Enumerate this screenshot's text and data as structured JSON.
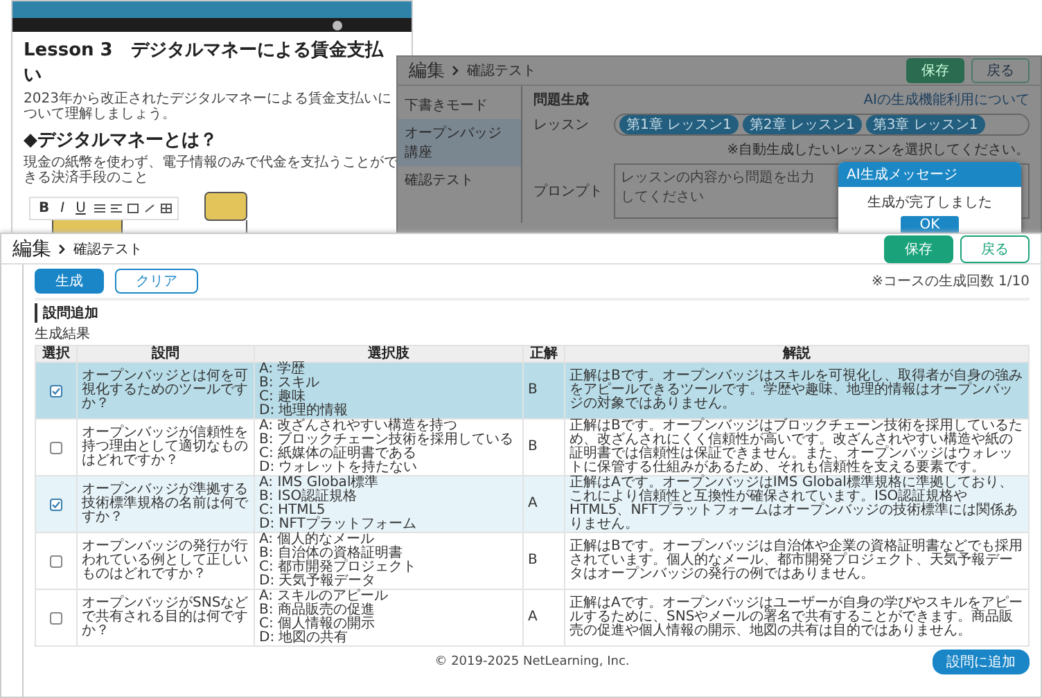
{
  "lesson_window": {
    "title": "Lesson 3　デジタルマネーによる賃金支払い",
    "intro": "2023年から改正されたデジタルマネーによる賃金支払いについて理解しましょう。",
    "heading": "◆デジタルマネーとは？",
    "definition": "現金の紙幣を使わず、電子情報のみで代金を支払うことができる決済手段のこと",
    "toolbar": [
      "B",
      "I",
      "U"
    ]
  },
  "background_editor": {
    "title": "編集",
    "breadcrumb": "確認テスト",
    "buttons": [
      {
        "label": "保存",
        "kind": "primary"
      },
      {
        "label": "戻る",
        "kind": "secondary"
      }
    ],
    "sidebar": {
      "items": [
        {
          "label": "下書きモード",
          "selected": false
        },
        {
          "label": "オープンバッジ講座",
          "selected": true
        },
        {
          "label": "確認テスト",
          "selected": false
        }
      ]
    },
    "section_title": "問題生成",
    "help_link": "AIの生成機能利用について",
    "lesson_field": {
      "label": "レッスン",
      "tags": [
        "第1章 レッスン1",
        "第2章 レッスン1",
        "第3章 レッスン1"
      ]
    },
    "note": "※自動生成したいレッスンを選択してください。",
    "prompt_field": {
      "label": "プロンプト",
      "placeholder": "レッスンの内容から問題を出力してください"
    },
    "dialog": {
      "title": "AI生成メッセージ",
      "message": "生成が完了しました",
      "button": "OK"
    }
  },
  "front_editor": {
    "title": "編集",
    "breadcrumb": "確認テスト",
    "buttons": [
      {
        "label": "保存",
        "kind": "primary"
      },
      {
        "label": "戻る",
        "kind": "secondary"
      }
    ],
    "actions": [
      {
        "label": "生成",
        "kind": "primary"
      },
      {
        "label": "クリア",
        "kind": "secondary"
      }
    ],
    "generation_count": "※コースの生成回数 1/10",
    "section_title": "設問追加",
    "results_label": "生成結果",
    "table": {
      "columns": [
        "選択",
        "設問",
        "選択肢",
        "正解",
        "解説"
      ],
      "rows": [
        {
          "checked": true,
          "hovered": true,
          "question": "オープンバッジとは何を可視化するためのツールですか？",
          "options": [
            "A: 学歴",
            "B: スキル",
            "C: 趣味",
            "D: 地理的情報"
          ],
          "answer": "B",
          "explanation": "正解はBです。オープンバッジはスキルを可視化し、取得者が自身の強みをアピールできるツールです。学歴や趣味、地理的情報はオープンバッジの対象ではありません。"
        },
        {
          "checked": false,
          "hovered": false,
          "question": "オープンバッジが信頼性を持つ理由として適切なものはどれですか？",
          "options": [
            "A: 改ざんされやすい構造を持つ",
            "B: ブロックチェーン技術を採用している",
            "C: 紙媒体の証明書である",
            "D: ウォレットを持たない"
          ],
          "answer": "B",
          "explanation": "正解はBです。オープンバッジはブロックチェーン技術を採用しているため、改ざんされにくく信頼性が高いです。改ざんされやすい構造や紙の証明書では信頼性は保証できません。また、オープンバッジはウォレットに保管する仕組みがあるため、それも信頼性を支える要素です。"
        },
        {
          "checked": true,
          "hovered": false,
          "question": "オープンバッジが準拠する技術標準規格の名前は何ですか？",
          "options": [
            "A: IMS Global標準",
            "B: ISO認証規格",
            "C: HTML5",
            "D: NFTプラットフォーム"
          ],
          "answer": "A",
          "explanation": "正解はAです。オープンバッジはIMS Global標準規格に準拠しており、これにより信頼性と互換性が確保されています。ISO認証規格やHTML5、NFTプラットフォームはオープンバッジの技術標準には関係ありません。"
        },
        {
          "checked": false,
          "hovered": false,
          "question": "オープンバッジの発行が行われている例として正しいものはどれですか？",
          "options": [
            "A: 個人的なメール",
            "B: 自治体の資格証明書",
            "C: 都市開発プロジェクト",
            "D: 天気予報データ"
          ],
          "answer": "B",
          "explanation": "正解はBです。オープンバッジは自治体や企業の資格証明書などでも採用されています。個人的なメール、都市開発プロジェクト、天気予報データはオープンバッジの発行の例ではありません。"
        },
        {
          "checked": false,
          "hovered": false,
          "question": "オープンバッジがSNSなどで共有される目的は何ですか？",
          "options": [
            "A: スキルのアピール",
            "B: 商品販売の促進",
            "C: 個人情報の開示",
            "D: 地図の共有"
          ],
          "answer": "A",
          "explanation": "正解はAです。オープンバッジはユーザーが自身の学びやスキルをアピールするために、SNSやメールの署名で共有することができます。商品販売の促進や個人情報の開示、地図の共有は目的ではありません。"
        }
      ]
    },
    "add_button": "設問に追加",
    "footer": "© 2019-2025 NetLearning, Inc."
  }
}
